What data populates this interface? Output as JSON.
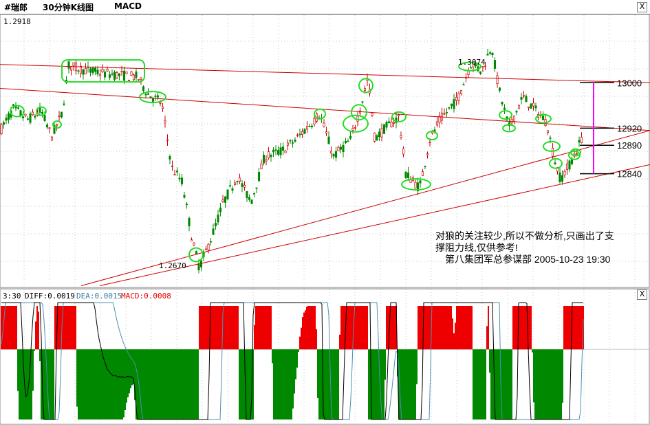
{
  "window": {
    "symbol": "#瑞郎",
    "period": "30分钟K线图",
    "indicator": "MACD",
    "close_glyph": "X"
  },
  "chart_data": [
    {
      "type": "candlestick",
      "ylim": [
        1.264,
        1.312
      ],
      "top_label": "1.2918",
      "colors": {
        "up": "#cc0000",
        "down": "#008800",
        "trendline": "#cc0000",
        "circle": "#22dd22",
        "marker": "#ff00ff"
      },
      "extreme_labels": {
        "high": "1.3074",
        "low": "1.2670"
      },
      "level_labels": [
        "13000",
        "12920",
        "12890",
        "12840"
      ],
      "trendlines_price": [
        {
          "name": "upper-resistance",
          "from": [
            0,
            1.3032
          ],
          "to": [
            945,
            1.3
          ]
        },
        {
          "name": "mid-resistance",
          "from": [
            0,
            1.299
          ],
          "to": [
            945,
            1.2916
          ]
        },
        {
          "name": "support-1",
          "from": [
            118,
            1.2643
          ],
          "to": [
            945,
            1.2916
          ]
        },
        {
          "name": "support-2",
          "from": [
            145,
            1.2643
          ],
          "to": [
            945,
            1.2856
          ]
        }
      ],
      "annotation": {
        "line1": "对狼的关注较少,所以不做分析,只画出了支",
        "line2": "撑阻力线,仅供参考!",
        "line3": "第八集团军总参谋部 2005-10-23 19:30"
      }
    },
    {
      "type": "bar",
      "title": "MACD",
      "header": {
        "prefix": "3:30",
        "diff_label": "DIFF:0.0019",
        "dea_label": "DEA:0.0015",
        "macd_label": "MACD:0.0008"
      },
      "colors": {
        "diff": "#000000",
        "dea": "#4a90b0",
        "pos": "#ee0000",
        "neg": "#008800"
      }
    }
  ]
}
